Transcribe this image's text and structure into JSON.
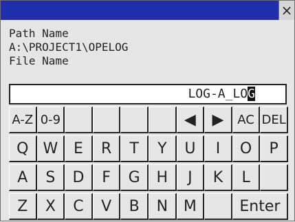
{
  "path_label": "Path Name",
  "path_value": "A:\\PROJECT1\\OPELOG",
  "file_label": "File Name",
  "filename": {
    "text": "LOG-A_LO",
    "cursor_char": "G"
  },
  "close_glyph": "×",
  "keyboard": {
    "rows": [
      [
        "A-Z",
        "0-9",
        "",
        "",
        "",
        "",
        "◀",
        "▶",
        "AC",
        "DEL"
      ],
      [
        "Q",
        "W",
        "E",
        "R",
        "T",
        "Y",
        "U",
        "I",
        "O",
        "P"
      ],
      [
        "A",
        "S",
        "D",
        "F",
        "G",
        "H",
        "J",
        "K",
        "L",
        ""
      ],
      [
        "Z",
        "X",
        "C",
        "V",
        "B",
        "N",
        "M",
        "",
        "Enter"
      ]
    ]
  }
}
